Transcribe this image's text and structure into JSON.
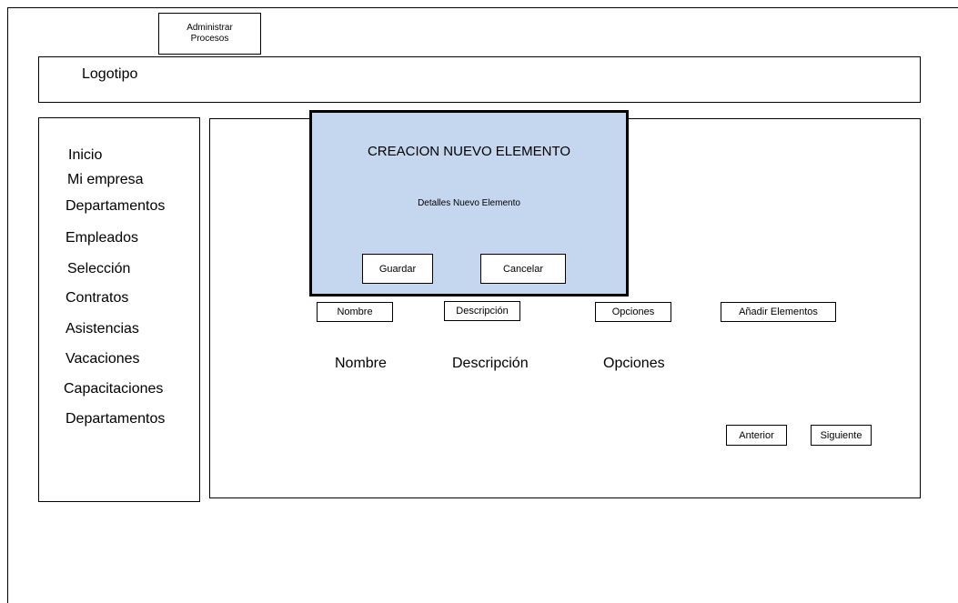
{
  "top_button": {
    "line1": "Administrar",
    "line2": "Procesos"
  },
  "header": {
    "logo": "Logotipo"
  },
  "sidebar": {
    "items": [
      {
        "label": "Inicio"
      },
      {
        "label": "Mi empresa"
      },
      {
        "label": "Departamentos"
      },
      {
        "label": "Empleados"
      },
      {
        "label": "Selección"
      },
      {
        "label": "Contratos"
      },
      {
        "label": "Asistencias"
      },
      {
        "label": "Vacaciones"
      },
      {
        "label": "Capacitaciones"
      },
      {
        "label": "Departamentos"
      }
    ]
  },
  "modal": {
    "title": "CREACION NUEVO ELEMENTO",
    "subtitle": "Detalles  Nuevo Elemento",
    "save_label": "Guardar",
    "cancel_label": "Cancelar",
    "background_color": "#c5d7ee"
  },
  "toolbar": {
    "nombre": "Nombre",
    "descripcion": "Descripción",
    "opciones": "Opciones",
    "add": "Añadir Elementos"
  },
  "table": {
    "headers": [
      "Nombre",
      "Descripción",
      "Opciones"
    ]
  },
  "pagination": {
    "prev": "Anterior",
    "next": "Siguiente"
  }
}
